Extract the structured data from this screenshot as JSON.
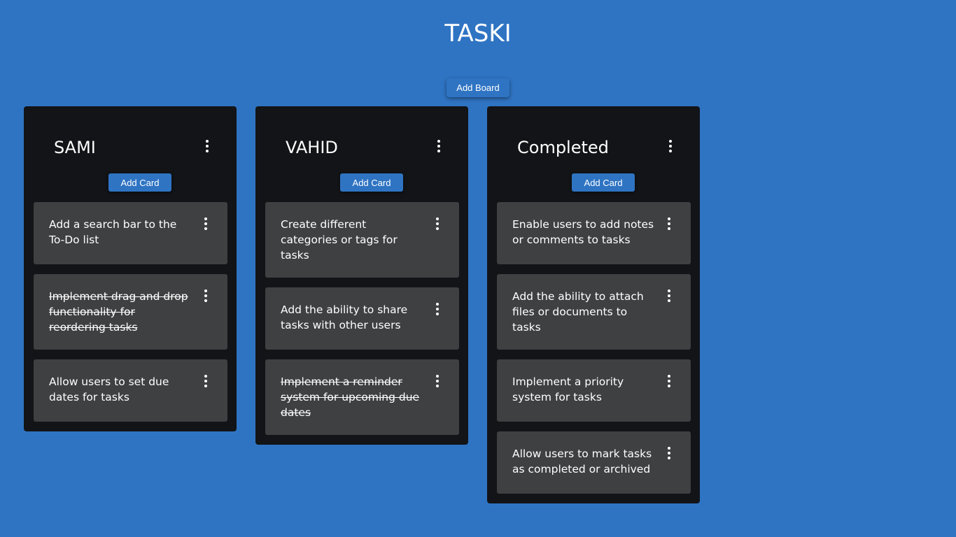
{
  "app": {
    "title": "TASKI",
    "add_board_label": "Add Board"
  },
  "boards": [
    {
      "title": "SAMI",
      "add_card_label": "Add Card",
      "cards": [
        {
          "text": "Add a search bar to the To-Do list",
          "completed": false
        },
        {
          "text": "Implement drag and drop functionality for reordering tasks",
          "completed": true
        },
        {
          "text": "Allow users to set due dates for tasks",
          "completed": false
        }
      ]
    },
    {
      "title": "VAHID",
      "add_card_label": "Add Card",
      "cards": [
        {
          "text": "Create different categories or tags for tasks",
          "completed": false
        },
        {
          "text": "Add the ability to share tasks with other users",
          "completed": false
        },
        {
          "text": "Implement a reminder system for upcoming due dates",
          "completed": true
        }
      ]
    },
    {
      "title": "Completed",
      "add_card_label": "Add Card",
      "cards": [
        {
          "text": "Enable users to add notes or comments to tasks",
          "completed": false
        },
        {
          "text": "Add the ability to attach files or documents to tasks",
          "completed": false
        },
        {
          "text": "Implement a priority system for tasks",
          "completed": false
        },
        {
          "text": "Allow users to mark tasks as completed or archived",
          "completed": false
        }
      ]
    }
  ],
  "colors": {
    "background": "#2f74c3",
    "board": "#121417",
    "card": "#3f4042",
    "button": "#2f74c3",
    "text": "#ffffff"
  },
  "icons": {
    "board_menu": "more-vertical-icon",
    "card_menu": "more-vertical-icon"
  }
}
